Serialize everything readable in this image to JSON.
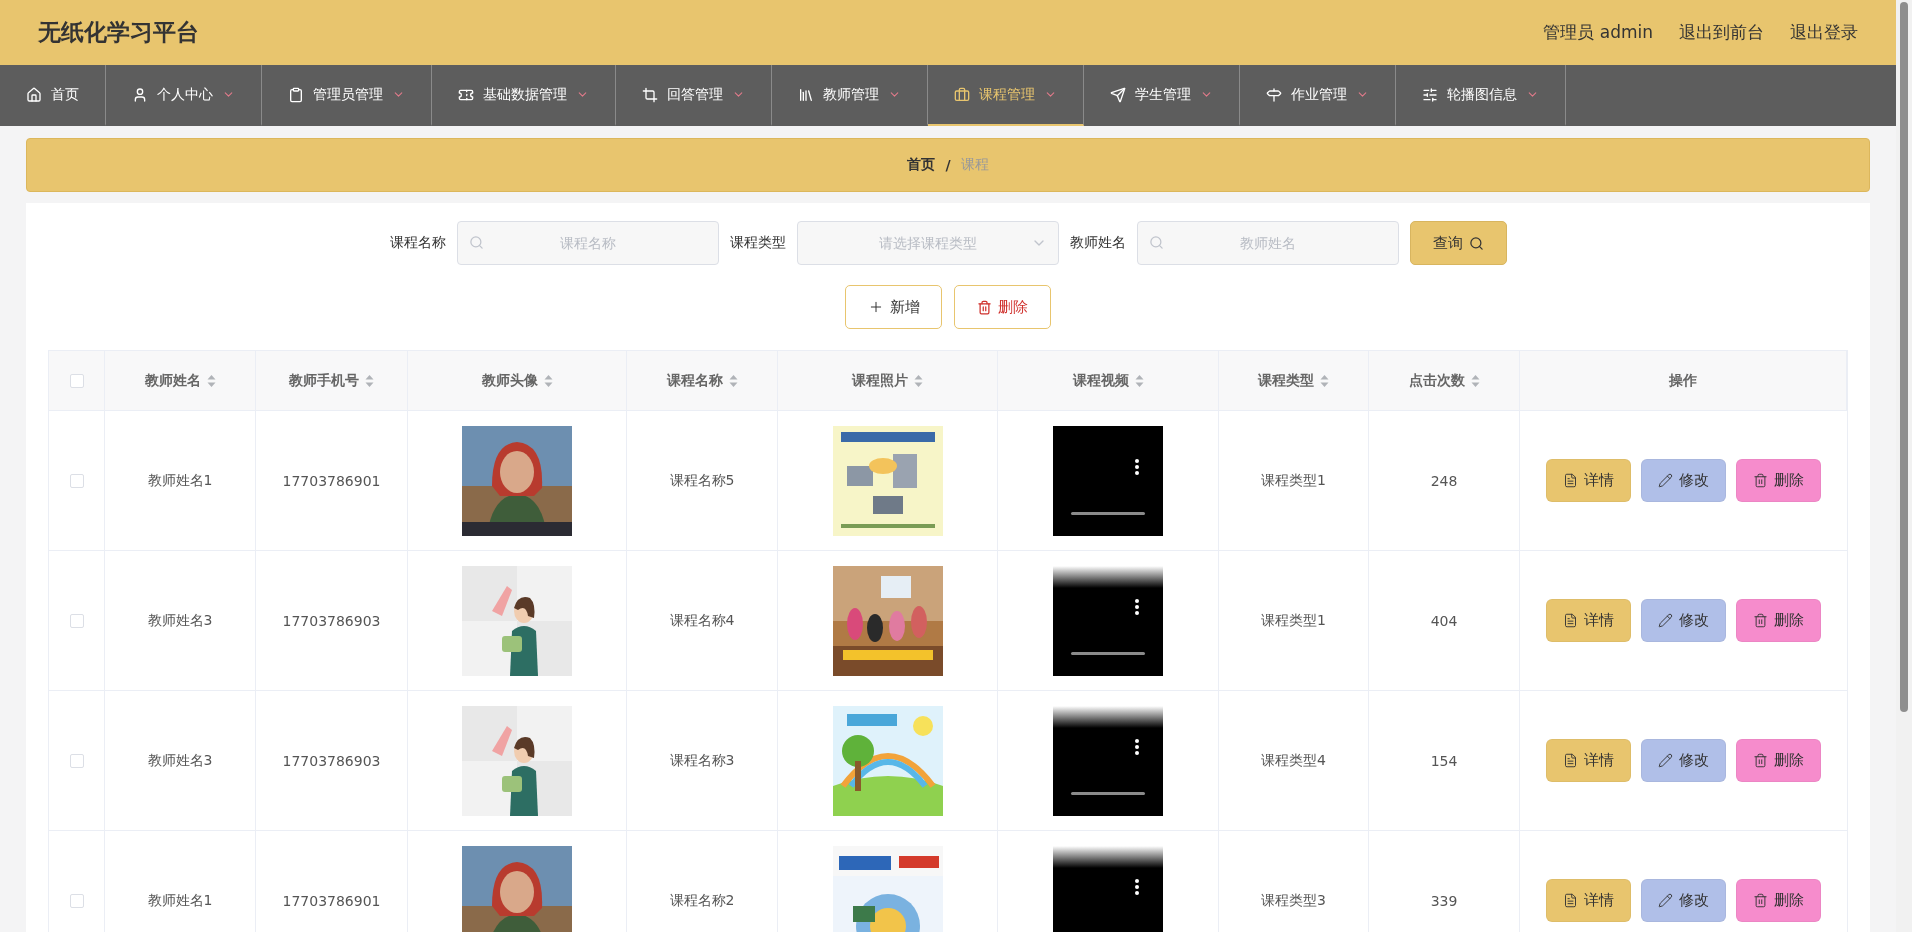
{
  "header": {
    "title": "无纸化学习平台",
    "user": "管理员 admin",
    "links": [
      "退出到前台",
      "退出登录"
    ]
  },
  "nav": {
    "items": [
      {
        "label": "首页",
        "selected": false,
        "dropdown": false
      },
      {
        "label": "个人中心",
        "selected": false,
        "dropdown": true
      },
      {
        "label": "管理员管理",
        "selected": false,
        "dropdown": true
      },
      {
        "label": "基础数据管理",
        "selected": false,
        "dropdown": true
      },
      {
        "label": "回答管理",
        "selected": false,
        "dropdown": true
      },
      {
        "label": "教师管理",
        "selected": false,
        "dropdown": true
      },
      {
        "label": "课程管理",
        "selected": true,
        "dropdown": true
      },
      {
        "label": "学生管理",
        "selected": false,
        "dropdown": true
      },
      {
        "label": "作业管理",
        "selected": false,
        "dropdown": true
      },
      {
        "label": "轮播图信息",
        "selected": false,
        "dropdown": true
      }
    ]
  },
  "breadcrumb": {
    "items": [
      "首页",
      "课程"
    ],
    "separator": "/"
  },
  "search": {
    "fields": [
      {
        "kind": "text",
        "label": "课程名称",
        "placeholder": "课程名称"
      },
      {
        "kind": "select",
        "label": "课程类型",
        "placeholder": "请选择课程类型"
      },
      {
        "kind": "text",
        "label": "教师姓名",
        "placeholder": "教师姓名"
      }
    ],
    "button": "查询"
  },
  "actions": [
    {
      "kind": "add",
      "label": "新增"
    },
    {
      "kind": "delete",
      "label": "删除"
    }
  ],
  "table": {
    "select_all_checked": false,
    "columns": [
      {
        "label": "教师姓名",
        "sortable": true
      },
      {
        "label": "教师手机号",
        "sortable": true
      },
      {
        "label": "教师头像",
        "sortable": true
      },
      {
        "label": "课程名称",
        "sortable": true
      },
      {
        "label": "课程照片",
        "sortable": true
      },
      {
        "label": "课程视频",
        "sortable": true
      },
      {
        "label": "课程类型",
        "sortable": true
      },
      {
        "label": "点击次数",
        "sortable": true
      },
      {
        "label": "操作",
        "sortable": false
      }
    ],
    "rows": [
      {
        "checked": false,
        "cells": [
          {
            "kind": "text",
            "text": "教师姓名1"
          },
          {
            "kind": "text",
            "text": "17703786901"
          },
          {
            "kind": "picture"
          },
          {
            "kind": "text",
            "text": "课程名称5"
          },
          {
            "kind": "picture"
          },
          {
            "kind": "video"
          },
          {
            "kind": "text",
            "text": "课程类型1"
          },
          {
            "kind": "text",
            "text": "248"
          }
        ],
        "buttons": [
          {
            "kind": "detail",
            "label": "详情"
          },
          {
            "kind": "edit",
            "label": "修改"
          },
          {
            "kind": "delete",
            "label": "删除"
          }
        ]
      },
      {
        "checked": false,
        "cells": [
          {
            "kind": "text",
            "text": "教师姓名3"
          },
          {
            "kind": "text",
            "text": "17703786903"
          },
          {
            "kind": "picture"
          },
          {
            "kind": "text",
            "text": "课程名称4"
          },
          {
            "kind": "picture"
          },
          {
            "kind": "video"
          },
          {
            "kind": "text",
            "text": "课程类型1"
          },
          {
            "kind": "text",
            "text": "404"
          }
        ],
        "buttons": [
          {
            "kind": "detail",
            "label": "详情"
          },
          {
            "kind": "edit",
            "label": "修改"
          },
          {
            "kind": "delete",
            "label": "删除"
          }
        ]
      },
      {
        "checked": false,
        "cells": [
          {
            "kind": "text",
            "text": "教师姓名3"
          },
          {
            "kind": "text",
            "text": "17703786903"
          },
          {
            "kind": "picture"
          },
          {
            "kind": "text",
            "text": "课程名称3"
          },
          {
            "kind": "picture"
          },
          {
            "kind": "video"
          },
          {
            "kind": "text",
            "text": "课程类型4"
          },
          {
            "kind": "text",
            "text": "154"
          }
        ],
        "buttons": [
          {
            "kind": "detail",
            "label": "详情"
          },
          {
            "kind": "edit",
            "label": "修改"
          },
          {
            "kind": "delete",
            "label": "删除"
          }
        ]
      },
      {
        "checked": false,
        "cells": [
          {
            "kind": "text",
            "text": "教师姓名1"
          },
          {
            "kind": "text",
            "text": "17703786901"
          },
          {
            "kind": "picture"
          },
          {
            "kind": "text",
            "text": "课程名称2"
          },
          {
            "kind": "picture"
          },
          {
            "kind": "video"
          },
          {
            "kind": "text",
            "text": "课程类型3"
          },
          {
            "kind": "text",
            "text": "339"
          }
        ],
        "buttons": [
          {
            "kind": "detail",
            "label": "详情"
          },
          {
            "kind": "edit",
            "label": "修改"
          },
          {
            "kind": "delete",
            "label": "删除"
          }
        ]
      }
    ]
  }
}
